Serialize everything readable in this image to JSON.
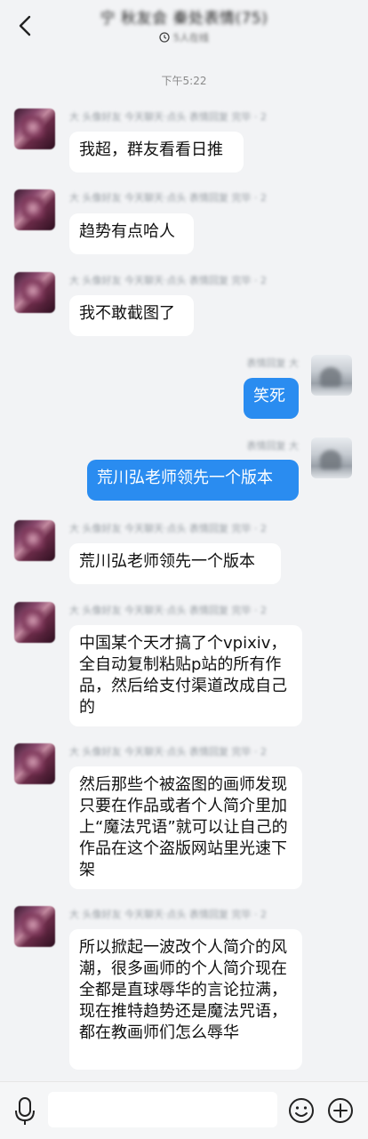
{
  "header": {
    "title": "宁 秋友会 秦处表情(75)",
    "subtitle": "5人在线",
    "subtitle_icon": "clock-icon"
  },
  "time_divider": "下午5:22",
  "messages": [
    {
      "sender": "大 头像好友   今天聊天·点头 表情回复 完毕 · 2",
      "text": "我超，群友看看日推",
      "from_me": false
    },
    {
      "sender": "大 头像好友   今天聊天·点头 表情回复 完毕 · 2",
      "text": "趋势有点哈人",
      "from_me": false
    },
    {
      "sender": "大 头像好友   今天聊天·点头 表情回复 完毕 · 2",
      "text": "我不敢截图了",
      "from_me": false
    },
    {
      "sender": "表情回复 大",
      "text": "笑死",
      "from_me": true
    },
    {
      "sender": "表情回复 大",
      "text": "荒川弘老师领先一个版本",
      "from_me": true
    },
    {
      "sender": "大 头像好友   今天聊天·点头 表情回复 完毕 · 2",
      "text": "荒川弘老师领先一个版本",
      "from_me": false
    },
    {
      "sender": "大 头像好友   今天聊天·点头 表情回复 完毕 · 2",
      "text": "中国某个天才搞了个vpixiv，全自动复制粘贴p站的所有作品，然后给支付渠道改成自己的",
      "from_me": false
    },
    {
      "sender": "大 头像好友   今天聊天·点头 表情回复 完毕 · 2",
      "text": "然后那些个被盗图的画师发现只要在作品或者个人简介里加上“魔法咒语”就可以让自己的作品在这个盗版网站里光速下架",
      "from_me": false
    },
    {
      "sender": "大 头像好友   今天聊天·点头 表情回复 完毕 · 2",
      "text": "所以掀起一波改个人简介的风潮，很多画师的个人简介现在全都是直球辱华的言论拉满，现在推特趋势还是魔法咒语，都在教画师们怎么辱华",
      "from_me": false
    }
  ],
  "input": {
    "placeholder": "",
    "value": ""
  },
  "icons": {
    "back": "chevron-left-icon",
    "mic": "microphone-icon",
    "emoji": "smiley-icon",
    "plus": "plus-circle-icon"
  },
  "colors": {
    "background": "#f2f3f5",
    "my_bubble": "#2a8cf0",
    "their_bubble": "#ffffff"
  }
}
